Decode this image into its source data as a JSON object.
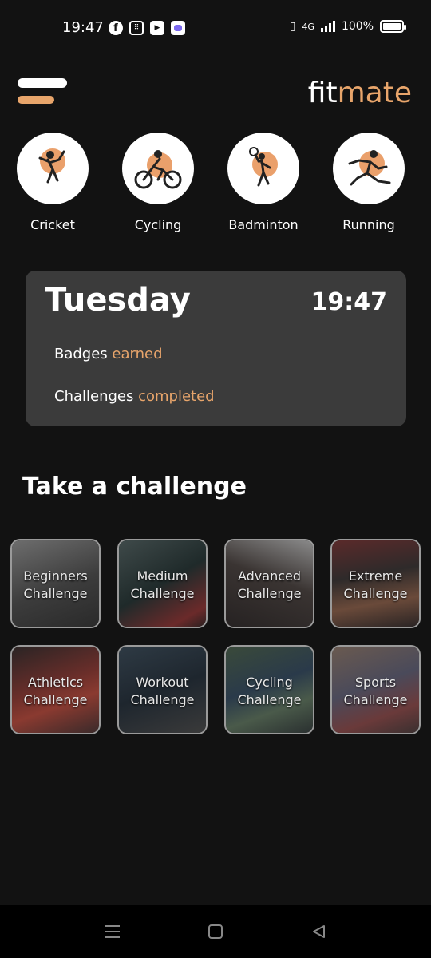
{
  "status_bar": {
    "time": "19:47",
    "network": "4G",
    "battery": "100%",
    "icons": [
      "facebook-icon",
      "grid-app-icon",
      "youtube-icon",
      "teams-icon"
    ]
  },
  "header": {
    "logo_fit": "fit",
    "logo_mate": "mate",
    "accent_color": "#e8a56b"
  },
  "sports": [
    {
      "label": "Cricket",
      "icon": "cricket-icon"
    },
    {
      "label": "Cycling",
      "icon": "cycling-icon"
    },
    {
      "label": "Badminton",
      "icon": "badminton-icon"
    },
    {
      "label": "Running",
      "icon": "running-icon"
    }
  ],
  "today": {
    "day": "Tuesday",
    "time": "19:47",
    "badges_label": "Badges",
    "badges_accent": "earned",
    "challenges_label": "Challenges",
    "challenges_accent": "completed"
  },
  "section_title": "Take a challenge",
  "challenges": [
    {
      "line1": "Beginners",
      "line2": "Challenge"
    },
    {
      "line1": "Medium",
      "line2": "Challenge"
    },
    {
      "line1": "Advanced",
      "line2": "Challenge"
    },
    {
      "line1": "Extreme",
      "line2": "Challenge"
    },
    {
      "line1": "Athletics",
      "line2": "Challenge"
    },
    {
      "line1": "Workout",
      "line2": "Challenge"
    },
    {
      "line1": "Cycling",
      "line2": "Challenge"
    },
    {
      "line1": "Sports",
      "line2": "Challenge"
    }
  ],
  "nav": [
    "recent-apps-icon",
    "home-icon",
    "back-icon"
  ]
}
